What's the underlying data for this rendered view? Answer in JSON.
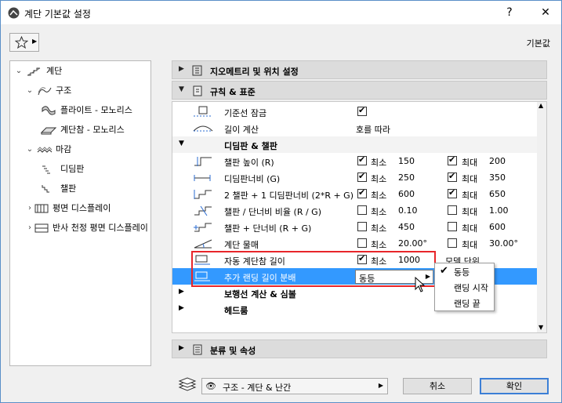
{
  "window": {
    "title": "계단 기본값 설정",
    "help_label": "?",
    "close_label": "✕"
  },
  "toolbar": {
    "favorites_icon": "star-icon",
    "default_label": "기본값"
  },
  "tree": {
    "items": [
      {
        "label": "계단",
        "icon": "stair-icon",
        "expanded": true
      },
      {
        "label": "구조",
        "icon": "structure-icon",
        "expanded": true
      },
      {
        "label": "플라이트 - 모노리스",
        "icon": "flight-icon"
      },
      {
        "label": "계단참 - 모노리스",
        "icon": "landing-icon"
      },
      {
        "label": "마감",
        "icon": "finish-icon",
        "expanded": true
      },
      {
        "label": "디딤판",
        "icon": "tread-icon"
      },
      {
        "label": "챌판",
        "icon": "riser-icon"
      },
      {
        "label": "평면 디스플레이",
        "icon": "floor-plan-icon",
        "expanded": false
      },
      {
        "label": "반사 천정 평면 디스플레이",
        "icon": "ceiling-plan-icon",
        "expanded": false
      }
    ]
  },
  "sections": {
    "geometry": "지오메트리 및 위치 설정",
    "rules": "규칙 & 표준",
    "classification": "분류 및 속성"
  },
  "rules": {
    "rows": {
      "baseline_lock": {
        "label": "기준선 잠금",
        "checked": true
      },
      "length_calc": {
        "label": "길이 계산",
        "value": "호를 따라"
      }
    },
    "tread_riser_head": "디딤판 & 챌판",
    "min_label": "최소",
    "max_label": "최대",
    "limits": [
      {
        "label": "챌판 높이 (R)",
        "min_on": true,
        "min": "150",
        "max_on": true,
        "max": "200"
      },
      {
        "label": "디딤판너비 (G)",
        "min_on": true,
        "min": "250",
        "max_on": true,
        "max": "350"
      },
      {
        "label": "2 챌판 + 1 디딤판너비 (2*R + G)",
        "min_on": true,
        "min": "600",
        "max_on": true,
        "max": "650"
      },
      {
        "label": "챌판 / 단너비 비율 (R / G)",
        "min_on": false,
        "min": "0.10",
        "max_on": false,
        "max": "1.00"
      },
      {
        "label": "챌판 + 단너비 (R + G)",
        "min_on": false,
        "min": "450",
        "max_on": false,
        "max": "600"
      },
      {
        "label": "계단 물매",
        "min_on": false,
        "min": "20.00°",
        "max_on": false,
        "max": "30.00°"
      }
    ],
    "auto_landing": {
      "label": "자동 계단참 길이",
      "min_on": true,
      "min_label": "최소",
      "min": "1000",
      "unit_label": "모델 단위"
    },
    "extra_landing": {
      "label": "추가 랜딩 길이 분배",
      "value": "동등"
    },
    "walkline_head": "보행선 계산 & 심볼",
    "headroom_head": "헤드룸"
  },
  "popup": {
    "options": [
      "동등",
      "랜딩 시작",
      "랜딩 끝"
    ],
    "selected": "동등"
  },
  "footer": {
    "layer_value": "구조 - 계단 & 난간",
    "cancel_label": "취소",
    "ok_label": "확인"
  }
}
